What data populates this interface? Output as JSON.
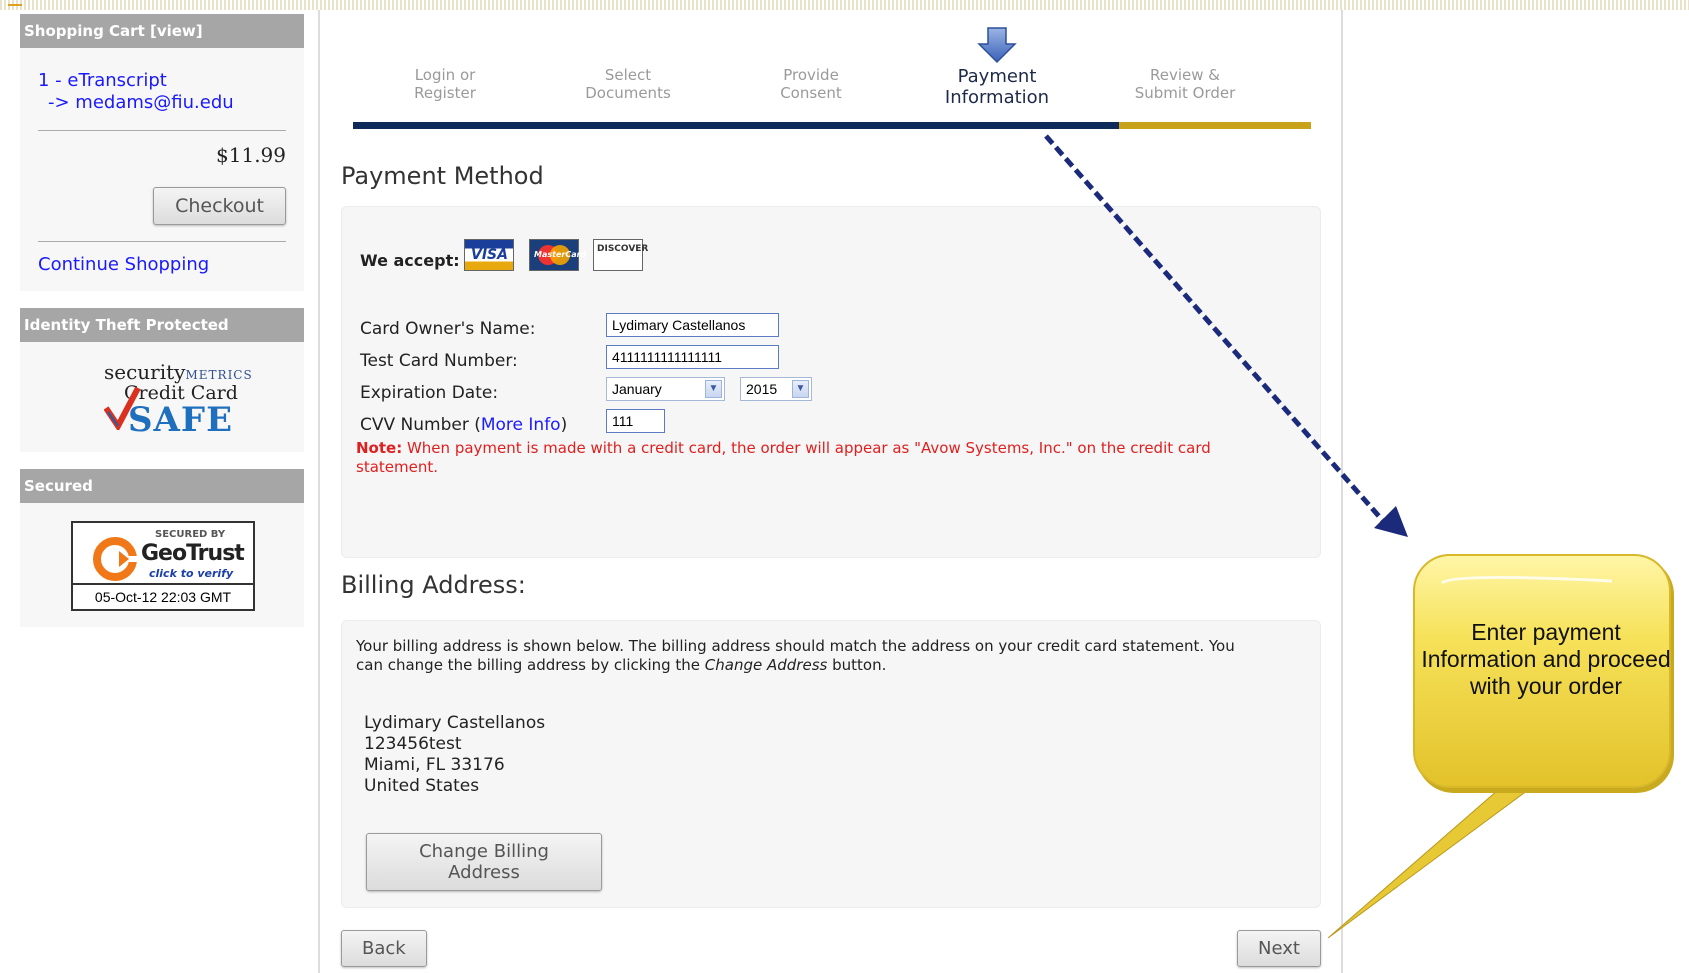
{
  "sidebar": {
    "cart": {
      "title": "Shopping Cart  [view]",
      "item_line1": "1 - eTranscript",
      "item_line2": "-> medams@fiu.edu",
      "price": "$11.99",
      "checkout_label": "Checkout",
      "continue_label": "Continue Shopping"
    },
    "identity": {
      "title": "Identity Theft Protected",
      "logo_word": "security",
      "logo_metrics": "METRICS",
      "logo_line2": "Credit Card",
      "logo_line3": "SAFE"
    },
    "secured": {
      "title": "Secured",
      "secured_by": "SECURED BY",
      "brand": "GeoTrust",
      "click": "click to verify",
      "date": "05-Oct-12 22:03 GMT"
    }
  },
  "steps": [
    {
      "line1": "Login or",
      "line2": "Register"
    },
    {
      "line1": "Select",
      "line2": "Documents"
    },
    {
      "line1": "Provide",
      "line2": "Consent"
    },
    {
      "line1": "Payment",
      "line2": "Information"
    },
    {
      "line1": "Review &",
      "line2": "Submit Order"
    }
  ],
  "payment": {
    "heading": "Payment Method",
    "we_accept": "We accept:",
    "cards": [
      "VISA",
      "MasterCard",
      "DISCOVER"
    ],
    "owner_label": "Card Owner's Name:",
    "owner_value": "Lydimary Castellanos",
    "number_label": "Test Card Number:",
    "number_value": "4111111111111111",
    "exp_label": "Expiration Date:",
    "exp_month": "January",
    "exp_year": "2015",
    "cvv_label_pre": "CVV Number (",
    "cvv_link": "More Info",
    "cvv_label_post": ")",
    "cvv_value": "111",
    "note_label": "Note:",
    "note_text": " When payment is made with a credit card, the order will appear as \"Avow Systems, Inc.\" on the credit card statement."
  },
  "billing": {
    "heading": "Billing Address:",
    "desc_pre": "Your billing address is shown below. The billing address should match the address on your credit card statement. You can change the billing address by clicking the ",
    "desc_em": "Change Address",
    "desc_post": " button.",
    "name": "Lydimary Castellanos",
    "street": "123456test",
    "city": "Miami, FL 33176",
    "country": "United States",
    "change_label": "Change Billing Address"
  },
  "nav": {
    "back_label": "Back",
    "next_label": "Next"
  },
  "callout": {
    "text": "Enter payment Information and proceed with your order"
  },
  "colors": {
    "progress_done": "#0e2a5a",
    "progress_todo": "#c9a21b",
    "note_red": "#e02020",
    "link_blue": "#1a1aff",
    "callout_yellow": "#f4df4a"
  }
}
